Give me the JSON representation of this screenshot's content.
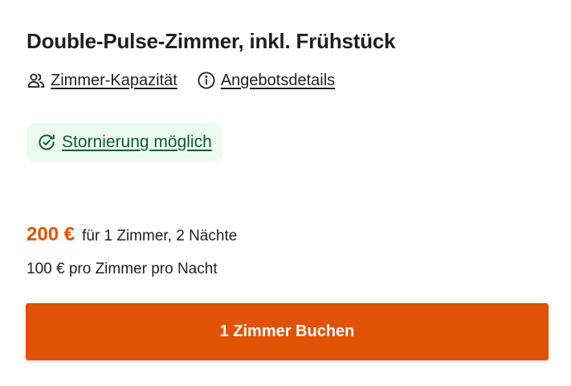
{
  "room": {
    "title": "Double-Pulse-Zimmer, inkl. Frühstück"
  },
  "links": {
    "capacity_label": "Zimmer-Kapazität",
    "details_label": "Angebotsdetails"
  },
  "cancellation": {
    "label": "Stornierung möglich",
    "color": "#0f5a33",
    "background": "#ebfbf1"
  },
  "pricing": {
    "total": "200 €",
    "total_detail": "für 1 Zimmer, 2 Nächte",
    "per_night": "100 € pro Zimmer pro Nacht",
    "accent_color": "#e05206"
  },
  "actions": {
    "book_label": "1 Zimmer Buchen"
  },
  "icons": {
    "capacity": "people-icon",
    "details": "info-icon",
    "cancellation": "clock-check-icon"
  }
}
